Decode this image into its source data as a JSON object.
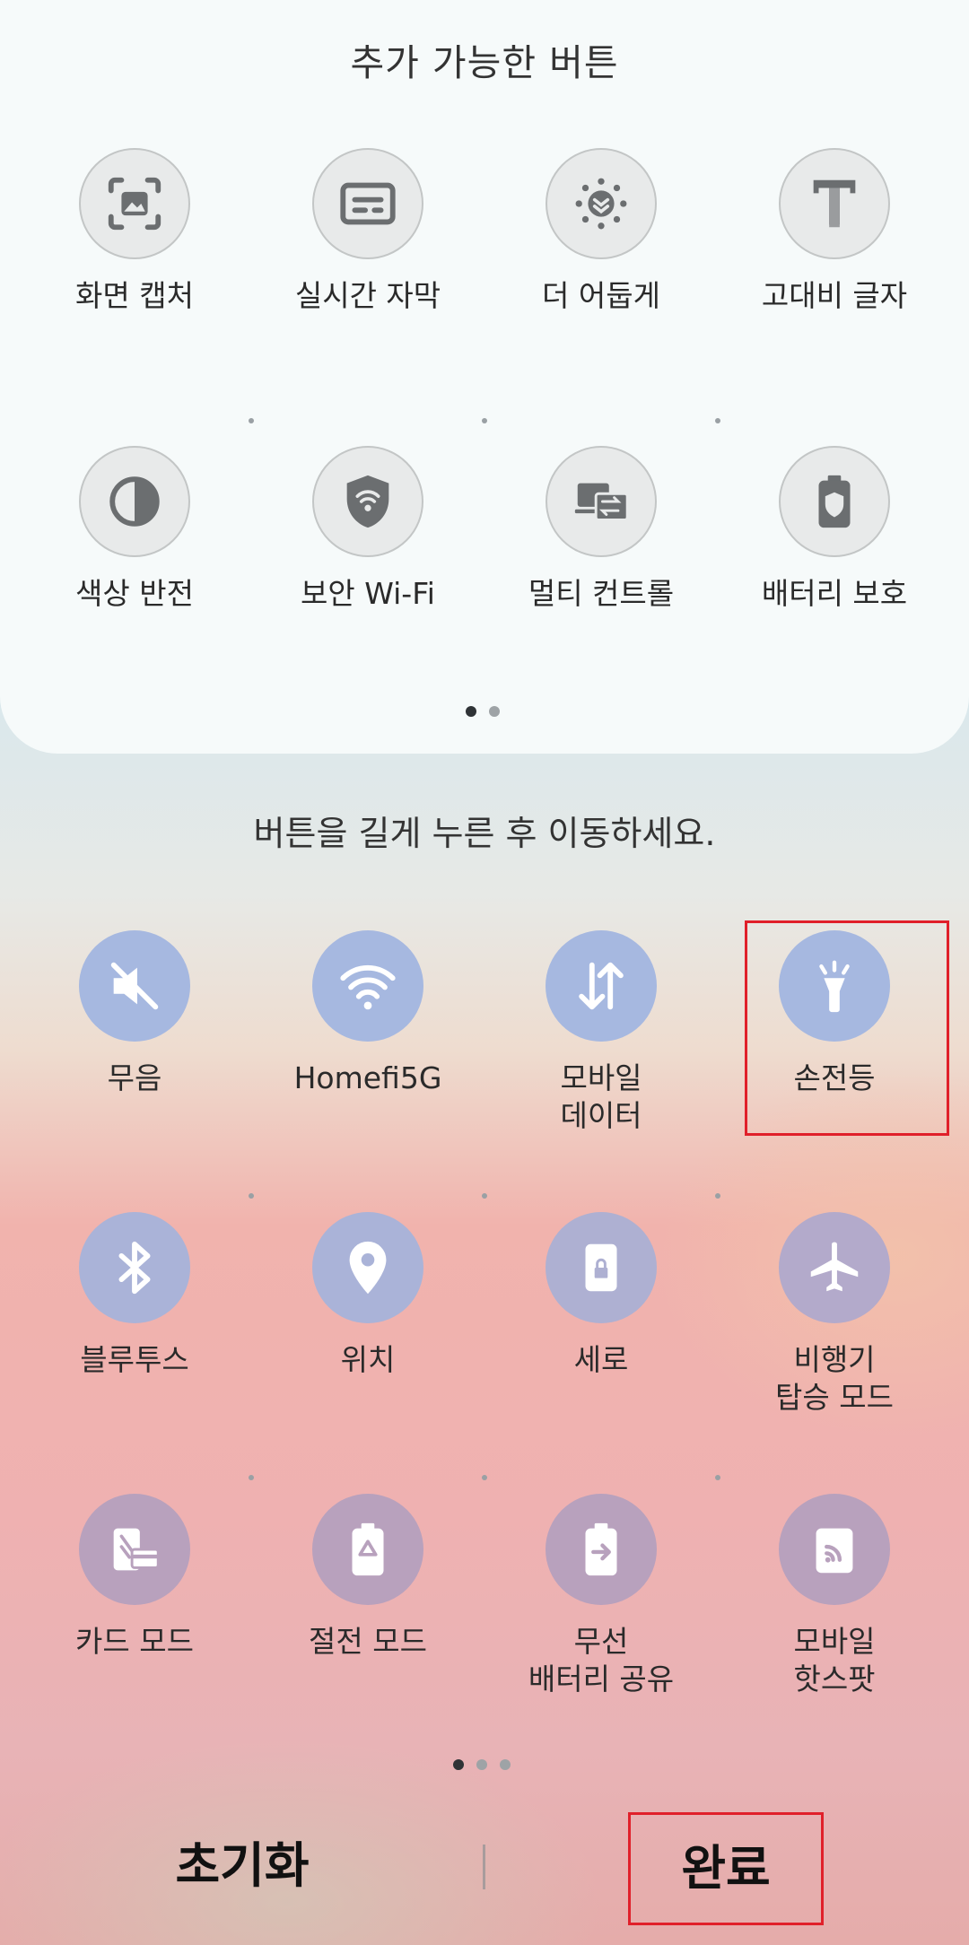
{
  "available": {
    "title": "추가 가능한 버튼",
    "tiles": [
      {
        "label": "화면 캡처",
        "icon": "screen-capture-icon"
      },
      {
        "label": "실시간 자막",
        "icon": "live-caption-icon"
      },
      {
        "label": "더 어둡게",
        "icon": "extra-dim-icon"
      },
      {
        "label": "고대비 글자",
        "icon": "high-contrast-text-icon"
      },
      {
        "label": "색상 반전",
        "icon": "color-inversion-icon"
      },
      {
        "label": "보안 Wi-Fi",
        "icon": "secure-wifi-icon"
      },
      {
        "label": "멀티 컨트롤",
        "icon": "multi-control-icon"
      },
      {
        "label": "배터리 보호",
        "icon": "battery-protect-icon"
      }
    ],
    "page_count": 2,
    "active_page": 1
  },
  "instruction": "버튼을 길게 누른 후 이동하세요.",
  "active": {
    "tiles": [
      {
        "label": "무음",
        "icon": "mute-icon"
      },
      {
        "label": "Homefi5G",
        "icon": "wifi-icon"
      },
      {
        "label": "모바일\n데이터",
        "icon": "mobile-data-icon"
      },
      {
        "label": "손전등",
        "icon": "flashlight-icon"
      },
      {
        "label": "블루투스",
        "icon": "bluetooth-icon"
      },
      {
        "label": "위치",
        "icon": "location-icon"
      },
      {
        "label": "세로",
        "icon": "portrait-lock-icon"
      },
      {
        "label": "비행기\n탑승 모드",
        "icon": "airplane-icon"
      },
      {
        "label": "카드 모드",
        "icon": "card-mode-icon"
      },
      {
        "label": "절전 모드",
        "icon": "power-saving-icon"
      },
      {
        "label": "무선\n배터리 공유",
        "icon": "wireless-power-share-icon"
      },
      {
        "label": "모바일\n핫스팟",
        "icon": "mobile-hotspot-icon"
      }
    ],
    "page_count": 3,
    "active_page": 1
  },
  "buttons": {
    "reset": "초기화",
    "done": "완료"
  },
  "colors": {
    "highlight": "#e0202a",
    "active_tile": "#a6b8e0",
    "inactive_tile": "#e8eaea"
  }
}
